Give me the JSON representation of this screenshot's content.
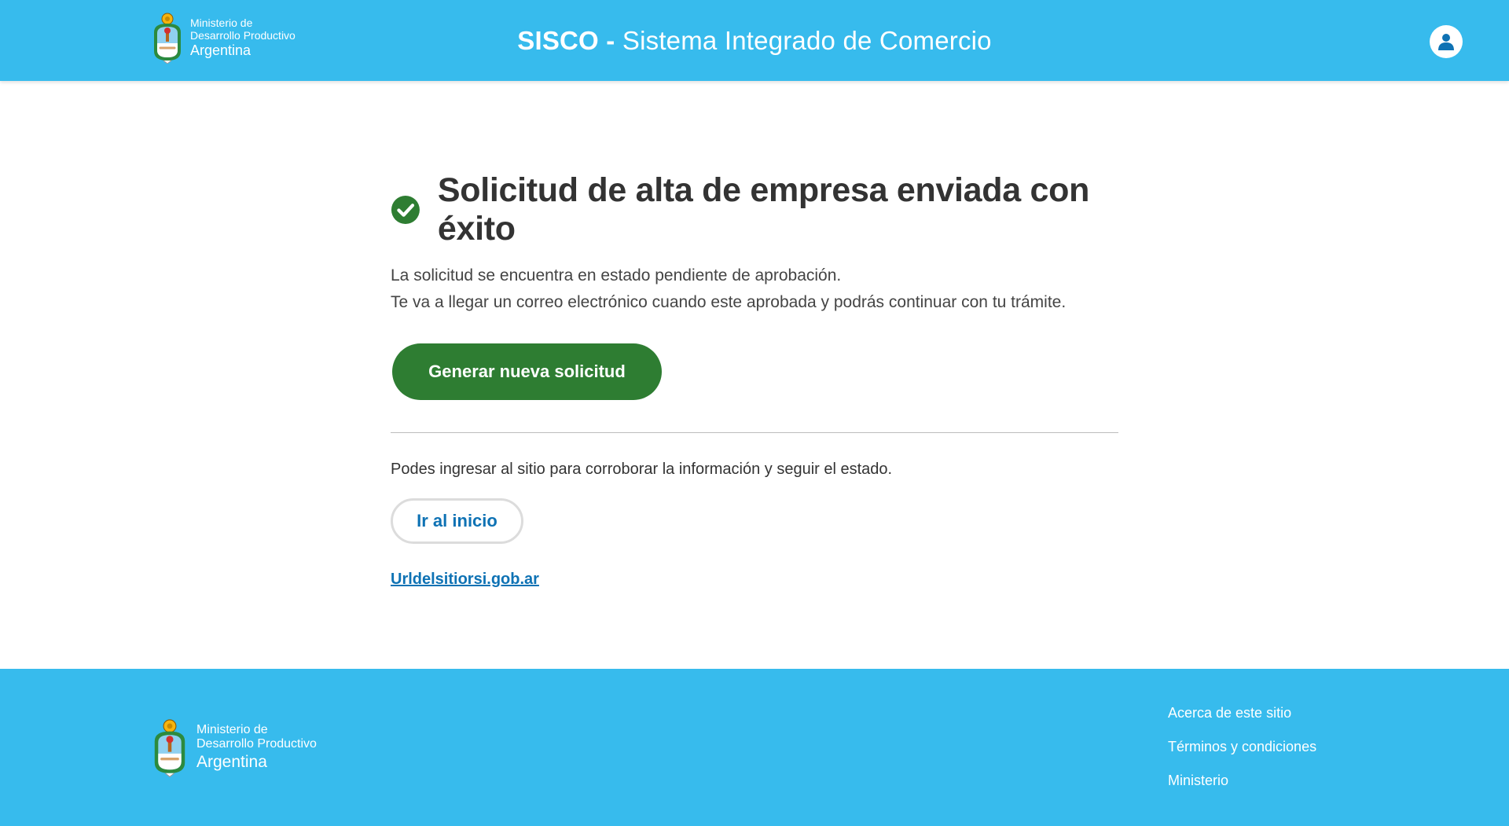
{
  "colors": {
    "header_bg": "#37bbed",
    "primary_green": "#2e7d32",
    "link_blue": "#0e72b4",
    "footer_bg": "#37bbed"
  },
  "header": {
    "logo": {
      "line1": "Ministerio de",
      "line2": "Desarrollo Productivo",
      "line3": "Argentina",
      "icon": "argentina-coat-of-arms-icon"
    },
    "title_acronym": "SISCO",
    "title_separator": " - ",
    "title_rest": "Sistema Integrado de Comercio",
    "user_icon": "user-icon"
  },
  "main": {
    "success_icon": "check-circle-icon",
    "heading": "Solicitud de alta de empresa enviada con éxito",
    "description_line1": "La solicitud se encuentra en estado pendiente de aprobación.",
    "description_line2": "Te va a llegar un correo electrónico cuando este aprobada y podrás continuar con tu trámite.",
    "primary_button": "Generar nueva solicitud",
    "info_text": "Podes ingresar al sitio para corroborar la información y seguir el estado.",
    "secondary_button": "Ir al inicio",
    "site_link": "Urldelsitiorsi.gob.ar"
  },
  "footer": {
    "logo": {
      "line1": "Ministerio de",
      "line2": "Desarrollo Productivo",
      "line3": "Argentina"
    },
    "links": [
      "Acerca de este sitio",
      "Términos y condiciones",
      "Ministerio"
    ]
  }
}
